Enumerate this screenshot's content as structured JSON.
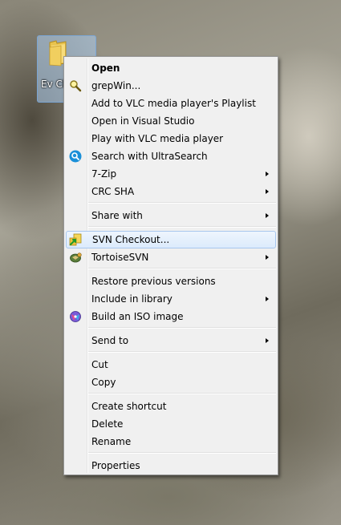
{
  "desktop_icon": {
    "caption": "Ev Che"
  },
  "menu": {
    "items": [
      {
        "label": "Open",
        "bold": true
      },
      {
        "label": "grepWin...",
        "icon": "magnifier-icon"
      },
      {
        "label": "Add to VLC media player's Playlist"
      },
      {
        "label": "Open in Visual Studio"
      },
      {
        "label": "Play with VLC media player"
      },
      {
        "label": "Search with UltraSearch",
        "icon": "ultrasearch-icon"
      },
      {
        "label": "7-Zip",
        "submenu": true
      },
      {
        "label": "CRC SHA",
        "submenu": true
      },
      {
        "label": "Share with",
        "submenu": true
      },
      {
        "label": "SVN Checkout...",
        "icon": "svn-checkout-icon",
        "highlighted": true
      },
      {
        "label": "TortoiseSVN",
        "icon": "tortoisesvn-icon",
        "submenu": true
      },
      {
        "label": "Restore previous versions"
      },
      {
        "label": "Include in library",
        "submenu": true
      },
      {
        "label": "Build an ISO image",
        "icon": "iso-disc-icon"
      },
      {
        "label": "Send to",
        "submenu": true
      },
      {
        "label": "Cut"
      },
      {
        "label": "Copy"
      },
      {
        "label": "Create shortcut"
      },
      {
        "label": "Delete"
      },
      {
        "label": "Rename"
      },
      {
        "label": "Properties"
      }
    ]
  },
  "colors": {
    "menu_background": "#f0f0f0",
    "highlight_border": "#a8c7ee",
    "selection_background": "#add1f5"
  }
}
